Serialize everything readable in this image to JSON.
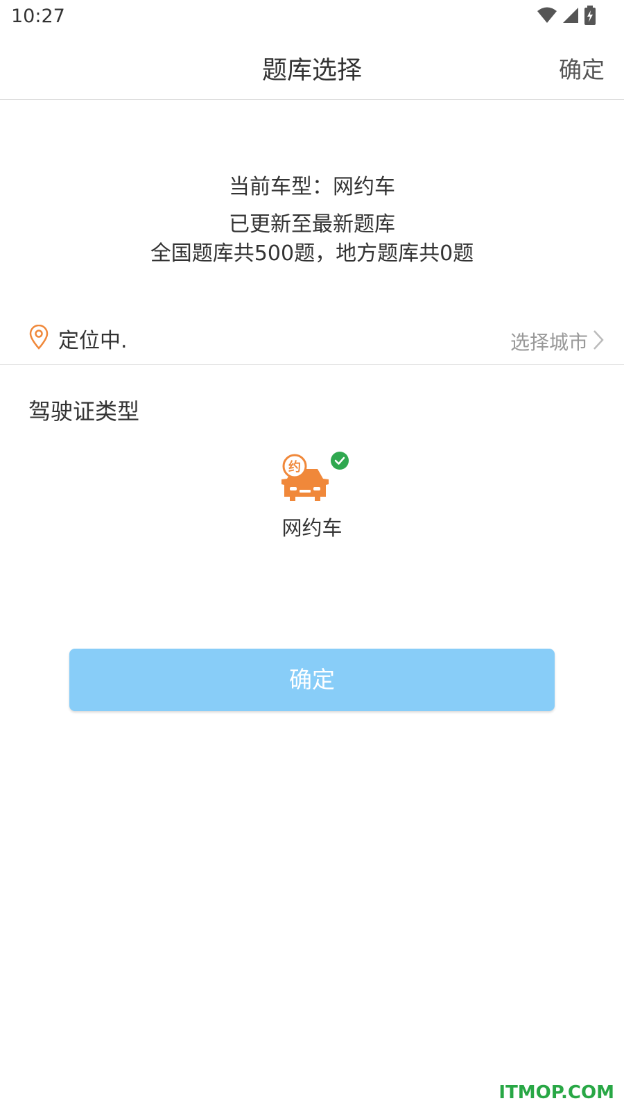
{
  "status_bar": {
    "time": "10:27",
    "icons": [
      "wifi-icon",
      "signal-icon",
      "battery-charging-icon"
    ]
  },
  "header": {
    "title": "题库选择",
    "confirm_label": "确定"
  },
  "info": {
    "vehicle_type": "当前车型：网约车",
    "update_status": "已更新至最新题库",
    "question_counts": "全国题库共500题，地方题库共0题"
  },
  "location": {
    "icon": "location-pin-icon",
    "status": "定位中.",
    "select_city_label": "选择城市"
  },
  "license_type": {
    "title": "驾驶证类型",
    "options": [
      {
        "label": "网约车",
        "badge": "约",
        "selected": true,
        "icon": "ride-hailing-car-icon"
      }
    ]
  },
  "confirm_button": {
    "label": "确定"
  },
  "watermark": {
    "text": "ITMOP.COM"
  },
  "colors": {
    "accent_orange": "#f0883a",
    "button_blue": "#88cdf8",
    "check_green": "#2fa84f",
    "watermark_green": "#28a745"
  }
}
